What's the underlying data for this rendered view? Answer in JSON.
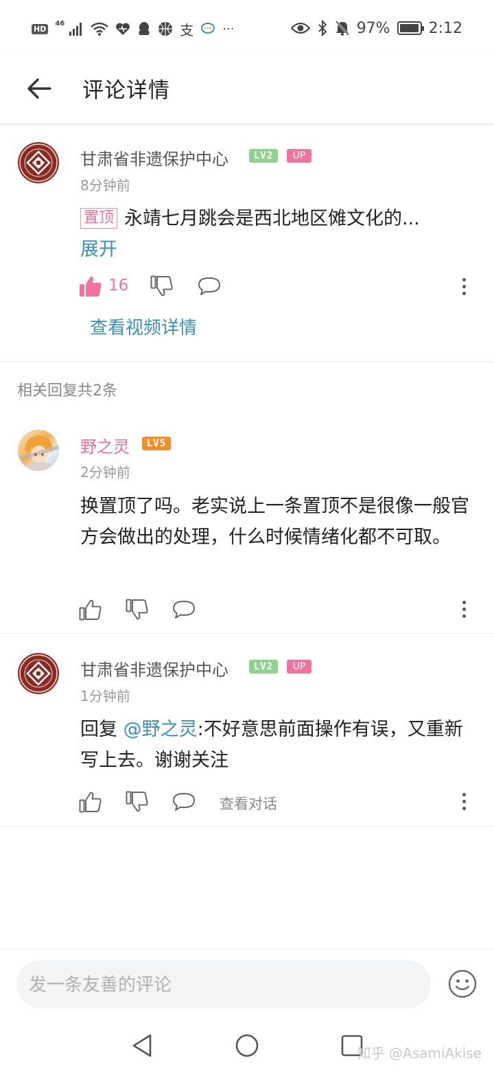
{
  "status_bar": {
    "hd": "HD",
    "network": "46",
    "alipay": "支",
    "more": "···",
    "battery": "97%",
    "battery_level": 0.97,
    "time": "2:12"
  },
  "app_bar": {
    "title": "评论详情"
  },
  "main_comment": {
    "user": "甘肃省非遗保护中心",
    "level": "LV2",
    "up_badge": "UP",
    "time": "8分钟前",
    "pin_tag": "置顶",
    "text": "永靖七月跳会是西北地区傩文化的...",
    "expand": "展开",
    "likes": "16",
    "view_video": "查看视频详情"
  },
  "replies_header": "相关回复共2条",
  "replies": [
    {
      "user": "野之灵",
      "level": "LV5",
      "time": "2分钟前",
      "text": "换置顶了吗。老实说上一条置顶不是很像一般官方会做出的处理，什么时候情绪化都不可取。"
    },
    {
      "user": "甘肃省非遗保护中心",
      "level": "LV2",
      "up_badge": "UP",
      "time": "1分钟前",
      "reply_prefix": "回复 ",
      "mention": "@野之灵",
      "text": ":不好意思前面操作有误，又重新写上去。谢谢关注",
      "view_dialog": "查看对话"
    }
  ],
  "input": {
    "placeholder": "发一条友善的评论"
  },
  "watermark": "知乎 @AsamiAkise",
  "colors": {
    "pink": "#f0729f",
    "link": "#3a8fb7",
    "lv2": "#8ed28e",
    "lv5": "#f0902c"
  }
}
